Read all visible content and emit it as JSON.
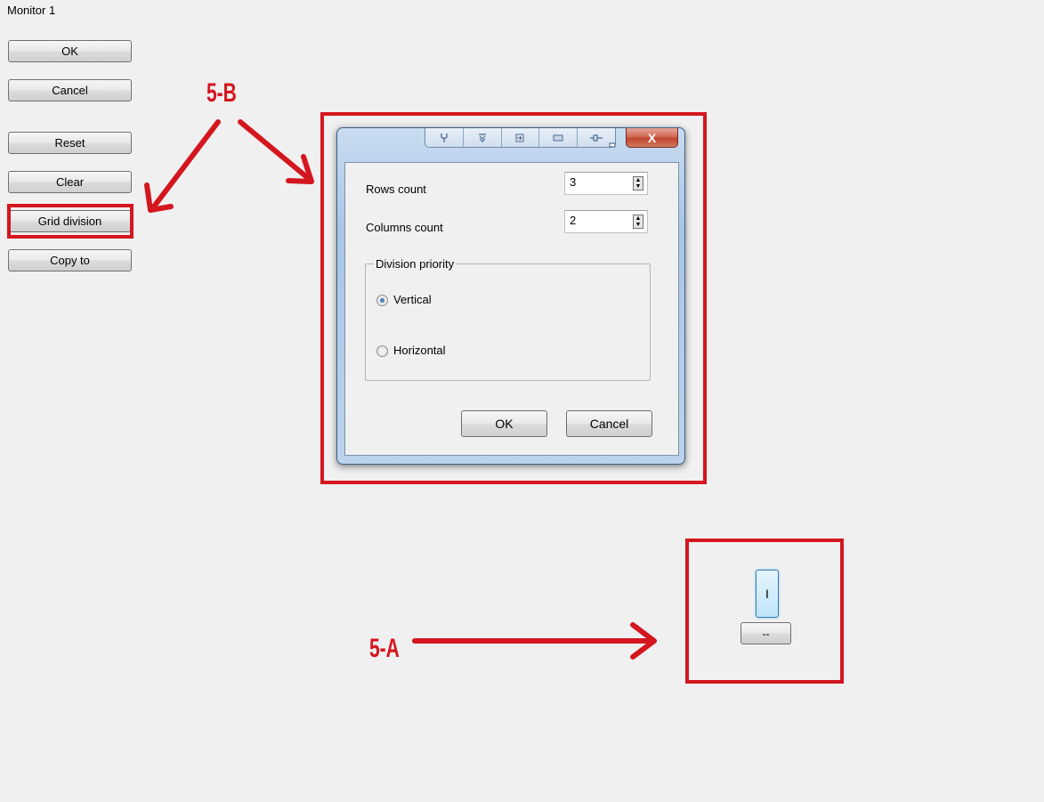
{
  "window": {
    "title": "Monitor 1"
  },
  "sidebar": {
    "ok_label": "OK",
    "cancel_label": "Cancel",
    "reset_label": "Reset",
    "clear_label": "Clear",
    "grid_division_label": "Grid division",
    "copy_to_label": "Copy to"
  },
  "annotations": {
    "label_b": "5-B",
    "label_a": "5-A",
    "color": "#d4161f"
  },
  "dialog": {
    "titlebar_icons": [
      "wrench-icon",
      "pin-icon",
      "enter-icon",
      "keyboard-icon",
      "plug-icon"
    ],
    "minimize_icon": "minimize-icon",
    "close_icon": "close-icon",
    "close_glyph": "X",
    "rows_label": "Rows count",
    "rows_value": "3",
    "columns_label": "Columns count",
    "columns_value": "2",
    "group_title": "Division priority",
    "vertical_label": "Vertical",
    "horizontal_label": "Horizontal",
    "selected_priority": "Vertical",
    "ok_label": "OK",
    "cancel_label": "Cancel"
  },
  "widget": {
    "toggle_label": "I",
    "dash_label": "--"
  }
}
